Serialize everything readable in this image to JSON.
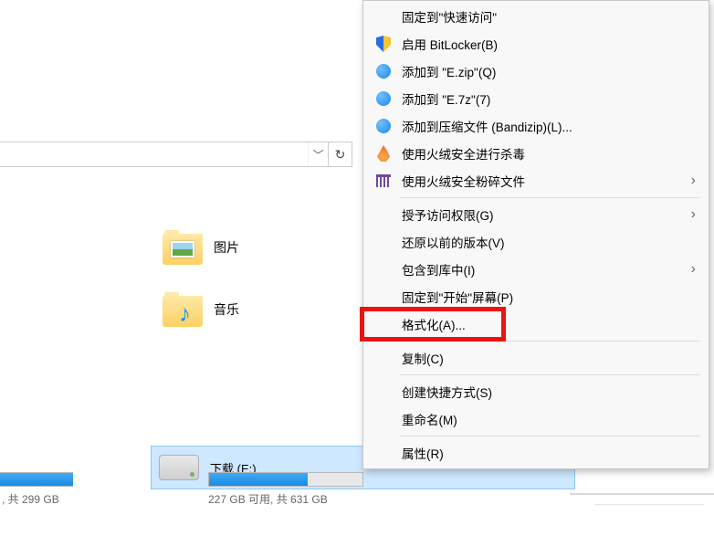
{
  "folders": {
    "pictures": "图片",
    "music": "音乐"
  },
  "drive": {
    "title": "下载 (E:)",
    "sub": "227 GB 可用, 共 631 GB",
    "fill_pct": 64
  },
  "left_drive_sub": ", 共 299 GB",
  "ctx": {
    "pin_quick": "固定到\"快速访问\"",
    "bitlocker": "启用 BitLocker(B)",
    "zip_e": "添加到 \"E.zip\"(Q)",
    "sevenz_e": "添加到 \"E.7z\"(7)",
    "bandizip": "添加到压缩文件 (Bandizip)(L)...",
    "huorong_scan": "使用火绒安全进行杀毒",
    "huorong_shred": "使用火绒安全粉碎文件",
    "grant_access": "授予访问权限(G)",
    "restore_prev": "还原以前的版本(V)",
    "include_lib": "包含到库中(I)",
    "pin_start": "固定到\"开始\"屏幕(P)",
    "format": "格式化(A)...",
    "copy": "复制(C)",
    "create_shortcut": "创建快捷方式(S)",
    "rename": "重命名(M)",
    "properties": "属性(R)"
  }
}
